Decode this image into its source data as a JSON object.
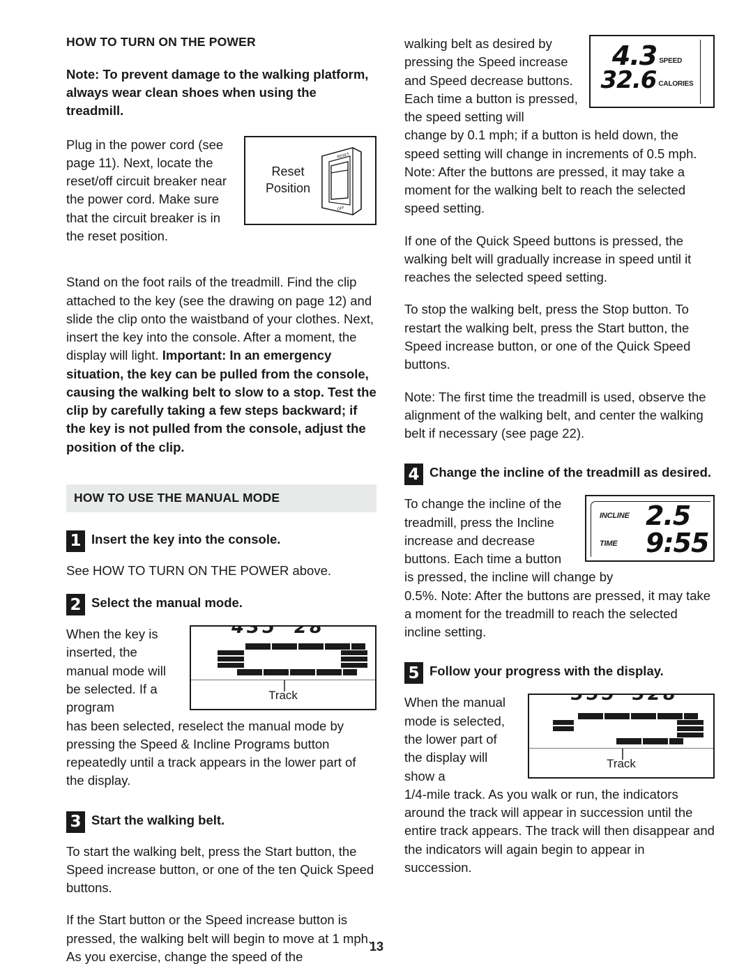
{
  "page": {
    "number": "13"
  },
  "left_column": {
    "heading_power": "HOW TO TURN ON THE POWER",
    "note_bold": "Note: To prevent damage to the walking platform, always wear clean shoes when using the treadmill.",
    "para_plug": "Plug in the power cord (see page 11). Next, locate the reset/off circuit breaker near the power cord. Make sure that the circuit breaker is in the reset position.",
    "reset_diagram": {
      "label_line1": "Reset",
      "label_line2": "Position",
      "switch_top_label": "RESET",
      "switch_bottom_label": "OFF"
    },
    "para_stand_plain": "Stand on the foot rails of the treadmill. Find the clip attached to the key (see the drawing on page 12) and slide the clip onto the waistband of your clothes. Next, insert the key into the console. After a moment, the display will light. ",
    "para_stand_bold": "Important: In an emergency situation, the key can be pulled from the console, causing the walking belt to slow to a stop. Test the clip by carefully taking a few steps backward; if the key is not pulled from the console, adjust the position of the clip.",
    "heading_manual": "HOW TO USE THE MANUAL MODE",
    "step1": {
      "number": "1",
      "title": "Insert the key into the console.",
      "body": "See HOW TO TURN ON THE POWER above."
    },
    "step2": {
      "number": "2",
      "title": "Select the manual mode.",
      "body_wrap": "When the key is inserted, the manual mode will be selected. If a program",
      "body_rest": "has been selected, reselect the manual mode by pressing the Speed & Incline Programs button repeatedly until a track appears in the lower part of the display.",
      "track_caption": "Track"
    },
    "step3": {
      "number": "3",
      "title": "Start the walking belt.",
      "body1": "To start the walking belt, press the Start button, the Speed increase button, or one of the ten Quick Speed buttons.",
      "body2": "If the Start button or the Speed increase button is pressed, the walking belt will begin to move at 1 mph. As you exercise, change the speed of the"
    }
  },
  "right_column": {
    "para_wrap_top": "walking belt as desired by pressing the Speed increase and Speed decrease buttons. Each time a button is pressed, the speed setting will",
    "speed_display": {
      "speed_value": "4.3",
      "speed_tag": "SPEED",
      "calories_value": "32.6",
      "calories_tag": "CALORIES"
    },
    "para_change": "change by 0.1 mph; if a button is held down, the speed setting will change in increments of 0.5 mph. Note: After the buttons are pressed, it may take a moment for the walking belt to reach the selected speed setting.",
    "para_quick": "If one of the Quick Speed buttons is pressed, the walking belt will gradually increase in speed until it reaches the selected speed setting.",
    "para_stop": "To stop the walking belt, press the Stop button. To restart the walking belt, press the Start button, the Speed increase button, or one of the Quick Speed buttons.",
    "para_note_align": "Note: The first time the treadmill is used, observe the alignment of the walking belt, and center the walking belt if necessary (see page 22).",
    "step4": {
      "number": "4",
      "title": "Change the incline of the treadmill as desired.",
      "body_wrap": "To change the incline of the treadmill, press the Incline increase and decrease buttons. Each time a button is pressed, the incline will change by",
      "body_rest": "0.5%. Note: After the buttons are pressed, it may take a moment for the treadmill to reach the selected incline setting.",
      "incline_display": {
        "incline_tag": "INCLINE",
        "incline_value": "2.5",
        "time_tag": "TIME",
        "time_value": "9:55"
      }
    },
    "step5": {
      "number": "5",
      "title": "Follow your progress with the display.",
      "body_wrap": "When the manual mode is selected, the lower part of the display will show a",
      "body_rest": "1/4-mile track. As you walk or run, the indicators around the track will appear in succession until the entire track appears. The track will then disappear and the indicators will again begin to appear in succession.",
      "track_caption": "Track"
    }
  }
}
